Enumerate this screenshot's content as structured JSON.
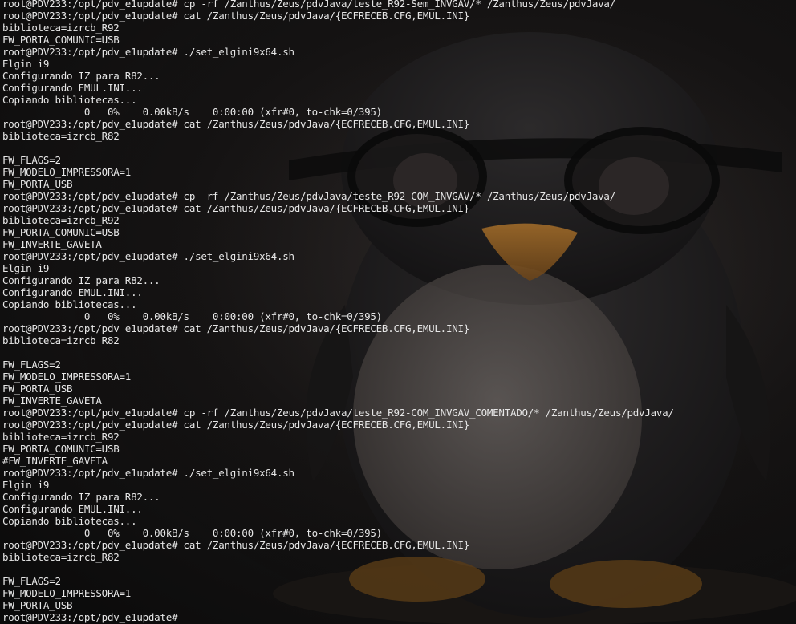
{
  "terminal": {
    "lines": [
      "root@PDV233:/opt/pdv_e1update# cp -rf /Zanthus/Zeus/pdvJava/teste_R92-Sem_INVGAV/* /Zanthus/Zeus/pdvJava/",
      "root@PDV233:/opt/pdv_e1update# cat /Zanthus/Zeus/pdvJava/{ECFRECEB.CFG,EMUL.INI}",
      "biblioteca=izrcb_R92",
      "FW_PORTA_COMUNIC=USB",
      "root@PDV233:/opt/pdv_e1update# ./set_elgini9x64.sh",
      "Elgin i9",
      "Configurando IZ para R82...",
      "Configurando EMUL.INI...",
      "Copiando bibliotecas...",
      "              0   0%    0.00kB/s    0:00:00 (xfr#0, to-chk=0/395)",
      "root@PDV233:/opt/pdv_e1update# cat /Zanthus/Zeus/pdvJava/{ECFRECEB.CFG,EMUL.INI}",
      "biblioteca=izrcb_R82",
      "",
      "FW_FLAGS=2",
      "FW_MODELO_IMPRESSORA=1",
      "FW_PORTA_USB",
      "root@PDV233:/opt/pdv_e1update# cp -rf /Zanthus/Zeus/pdvJava/teste_R92-COM_INVGAV/* /Zanthus/Zeus/pdvJava/",
      "root@PDV233:/opt/pdv_e1update# cat /Zanthus/Zeus/pdvJava/{ECFRECEB.CFG,EMUL.INI}",
      "biblioteca=izrcb_R92",
      "FW_PORTA_COMUNIC=USB",
      "FW_INVERTE_GAVETA",
      "root@PDV233:/opt/pdv_e1update# ./set_elgini9x64.sh",
      "Elgin i9",
      "Configurando IZ para R82...",
      "Configurando EMUL.INI...",
      "Copiando bibliotecas...",
      "              0   0%    0.00kB/s    0:00:00 (xfr#0, to-chk=0/395)",
      "root@PDV233:/opt/pdv_e1update# cat /Zanthus/Zeus/pdvJava/{ECFRECEB.CFG,EMUL.INI}",
      "biblioteca=izrcb_R82",
      "",
      "FW_FLAGS=2",
      "FW_MODELO_IMPRESSORA=1",
      "FW_PORTA_USB",
      "FW_INVERTE_GAVETA",
      "root@PDV233:/opt/pdv_e1update# cp -rf /Zanthus/Zeus/pdvJava/teste_R92-COM_INVGAV_COMENTADO/* /Zanthus/Zeus/pdvJava/",
      "root@PDV233:/opt/pdv_e1update# cat /Zanthus/Zeus/pdvJava/{ECFRECEB.CFG,EMUL.INI}",
      "biblioteca=izrcb_R92",
      "FW_PORTA_COMUNIC=USB",
      "#FW_INVERTE_GAVETA",
      "root@PDV233:/opt/pdv_e1update# ./set_elgini9x64.sh",
      "Elgin i9",
      "Configurando IZ para R82...",
      "Configurando EMUL.INI...",
      "Copiando bibliotecas...",
      "              0   0%    0.00kB/s    0:00:00 (xfr#0, to-chk=0/395)",
      "root@PDV233:/opt/pdv_e1update# cat /Zanthus/Zeus/pdvJava/{ECFRECEB.CFG,EMUL.INI}",
      "biblioteca=izrcb_R82",
      "",
      "FW_FLAGS=2",
      "FW_MODELO_IMPRESSORA=1",
      "FW_PORTA_USB",
      "root@PDV233:/opt/pdv_e1update#"
    ],
    "colors": {
      "text": "#e6e6e6",
      "background": "#0b0b0c"
    },
    "wallpaper": "penguin-with-goggles"
  }
}
